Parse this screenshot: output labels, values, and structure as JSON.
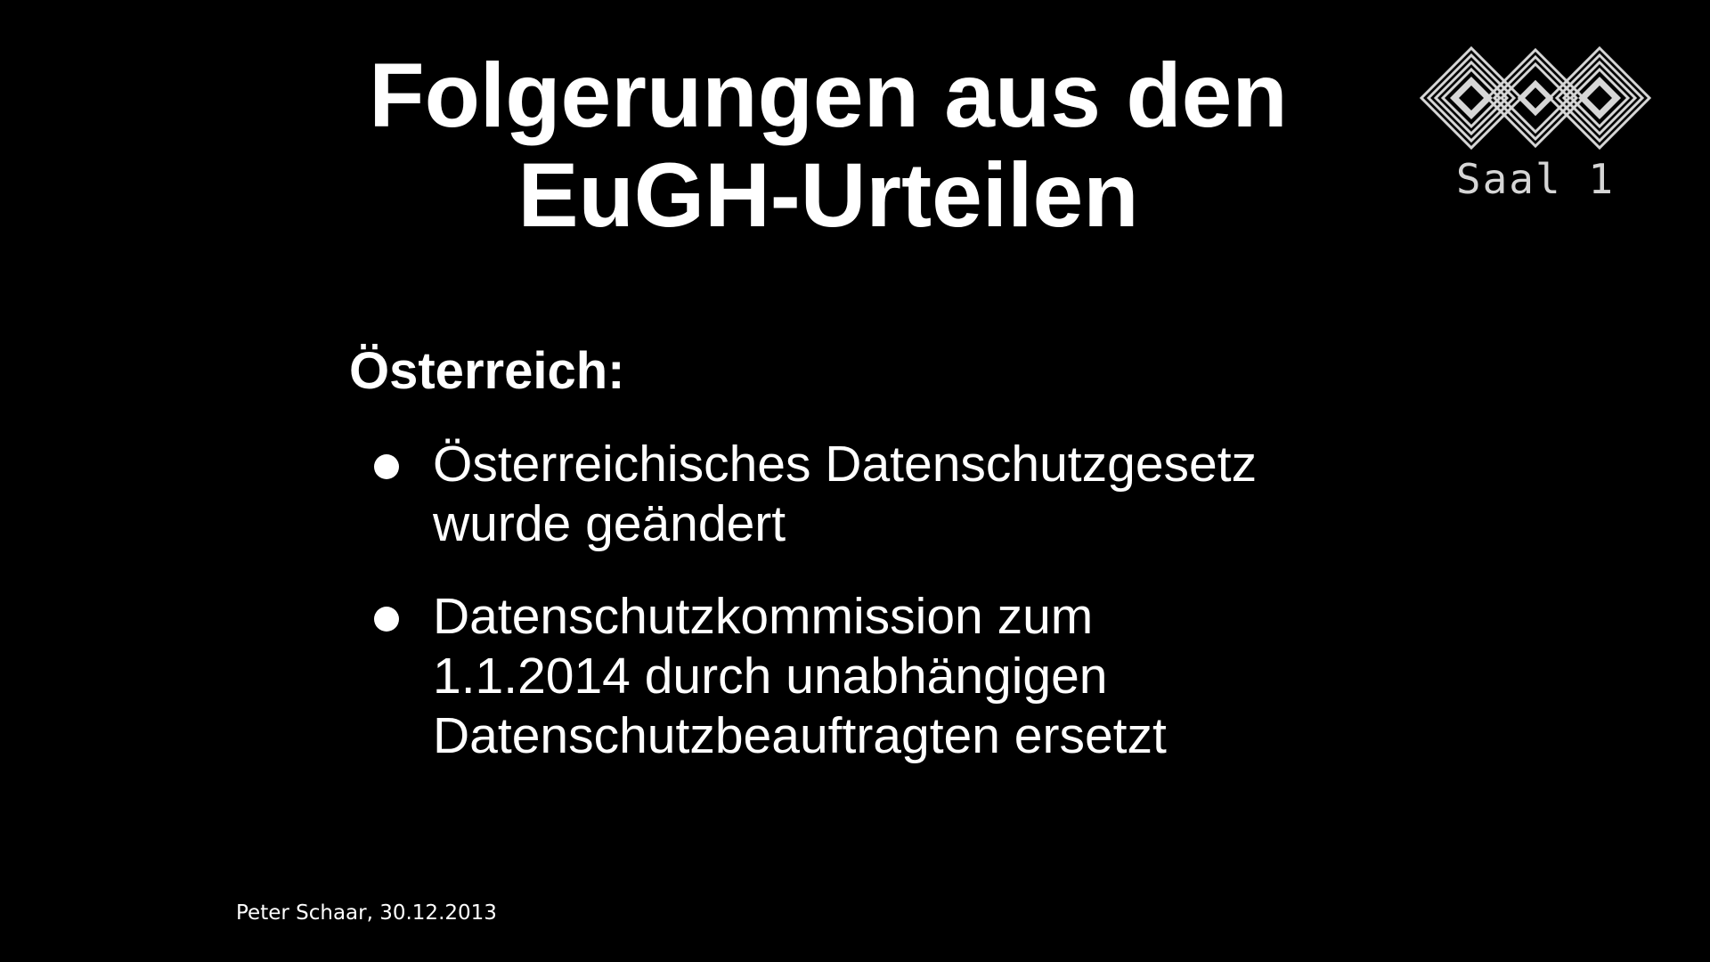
{
  "slide": {
    "title_line_1": "Folgerungen aus den",
    "title_line_2": "EuGH-Urteilen",
    "section_heading": "Österreich:",
    "bullets": [
      {
        "lines": [
          "Österreichisches Datenschutzgesetz",
          "wurde geändert"
        ]
      },
      {
        "lines": [
          "Datenschutzkommission zum",
          "1.1.2014 durch unabhängigen",
          "Datenschutzbeauftragten ersetzt"
        ]
      }
    ],
    "footer": "Peter Schaar, 30.12.2013"
  },
  "logo": {
    "icon": "30c3-logo-icon",
    "caption": "Saal 1"
  },
  "colors": {
    "background": "#000000",
    "text": "#ffffff",
    "logo": "#d6d6d6"
  }
}
